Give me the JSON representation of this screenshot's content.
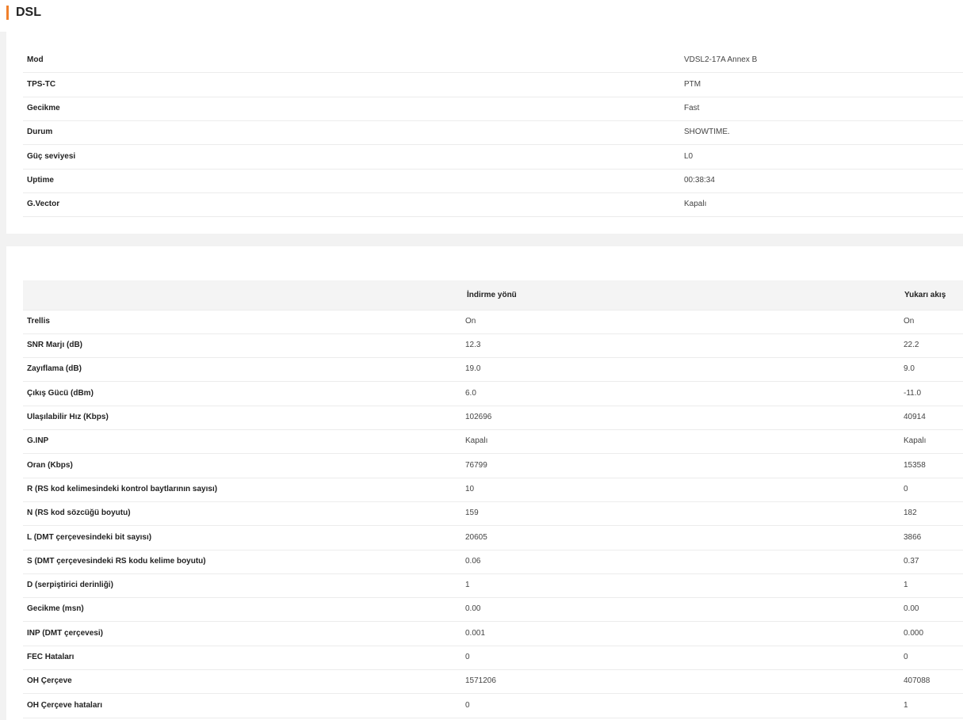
{
  "header": {
    "title": "DSL",
    "accent_color": "#f0802c"
  },
  "status": {
    "rows": [
      {
        "label": "Mod",
        "value": "VDSL2-17A Annex B"
      },
      {
        "label": "TPS-TC",
        "value": "PTM"
      },
      {
        "label": "Gecikme",
        "value": "Fast"
      },
      {
        "label": "Durum",
        "value": "SHOWTIME."
      },
      {
        "label": "Güç seviyesi",
        "value": "L0"
      },
      {
        "label": "Uptime",
        "value": "00:38:34"
      },
      {
        "label": "G.Vector",
        "value": "Kapalı"
      }
    ]
  },
  "stats": {
    "columns": {
      "downstream": "İndirme yönü",
      "upstream": "Yukarı akış"
    },
    "rows": [
      {
        "label": "Trellis",
        "down": "On",
        "up": "On"
      },
      {
        "label": "SNR Marjı (dB)",
        "down": "12.3",
        "up": "22.2"
      },
      {
        "label": "Zayıflama (dB)",
        "down": "19.0",
        "up": "9.0"
      },
      {
        "label": "Çıkış Gücü (dBm)",
        "down": "6.0",
        "up": "-11.0"
      },
      {
        "label": "Ulaşılabilir Hız (Kbps)",
        "down": "102696",
        "up": "40914"
      },
      {
        "label": "G.INP",
        "down": "Kapalı",
        "up": "Kapalı"
      },
      {
        "label": "Oran (Kbps)",
        "down": "76799",
        "up": "15358"
      },
      {
        "label": "R (RS kod kelimesindeki kontrol baytlarının sayısı)",
        "down": "10",
        "up": "0"
      },
      {
        "label": "N (RS kod sözcüğü boyutu)",
        "down": "159",
        "up": "182"
      },
      {
        "label": "L (DMT çerçevesindeki bit sayısı)",
        "down": "20605",
        "up": "3866"
      },
      {
        "label": "S (DMT çerçevesindeki RS kodu kelime boyutu)",
        "down": "0.06",
        "up": "0.37"
      },
      {
        "label": "D (serpiştirici derinliği)",
        "down": "1",
        "up": "1"
      },
      {
        "label": "Gecikme (msn)",
        "down": "0.00",
        "up": "0.00"
      },
      {
        "label": "INP (DMT çerçevesi)",
        "down": "0.001",
        "up": "0.000"
      },
      {
        "label": "FEC Hataları",
        "down": "0",
        "up": "0"
      },
      {
        "label": "OH Çerçeve",
        "down": "1571206",
        "up": "407088"
      },
      {
        "label": "OH Çerçeve hataları",
        "down": "0",
        "up": "1"
      }
    ]
  }
}
